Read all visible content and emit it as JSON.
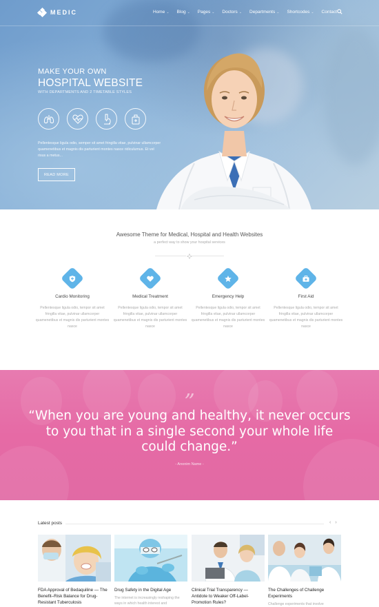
{
  "brand": {
    "name": "MEDIC"
  },
  "nav": {
    "items": [
      {
        "label": "Home",
        "dropdown": true
      },
      {
        "label": "Blog",
        "dropdown": true
      },
      {
        "label": "Pages",
        "dropdown": true
      },
      {
        "label": "Doctors",
        "dropdown": true
      },
      {
        "label": "Departments",
        "dropdown": true
      },
      {
        "label": "Shortcodes",
        "dropdown": true
      },
      {
        "label": "Contact",
        "dropdown": false
      }
    ]
  },
  "hero": {
    "line1": "MAKE YOUR OWN",
    "line2": "HOSPITAL WEBSITE",
    "line3": "WITH DEPARTMENTS AND 2 TIMETABLE STYLES",
    "icons": [
      "lungs-icon",
      "heart-pulse-icon",
      "microscope-icon",
      "medicine-bag-icon"
    ],
    "paragraph": "Pellentesque ligula odio, semper sit amet fringilla vitae, pulvinar ullamcorper quamenetibus et magnis dis parturient montes nasce ridiculumus. Et vel risus a metus...",
    "button": "READ MORE"
  },
  "services": {
    "title": "Awesome Theme for Medical, Hospital and Health Websites",
    "subtitle": "a perfect way to show your hospital services",
    "items": [
      {
        "title": "Cardio Monitoring",
        "icon": "shield-icon",
        "desc": "Pellentesque ligula odio, tempor sit amet fringilla vitae, pulvinar ullamcorper quamenetibus et magnis dis parturient montes nasce"
      },
      {
        "title": "Medical Treatment",
        "icon": "heart-icon",
        "desc": "Pellentesque ligula odio, tempor sit amet fringilla vitae, pulvinar ullamcorper quamenetibus et magnis dis parturient montes nasce"
      },
      {
        "title": "Emergency Help",
        "icon": "star-icon",
        "desc": "Pellentesque ligula odio, tempor sit amet fringilla vitae, pulvinar ullamcorper quamenetibus et magnis dis parturient montes nasce"
      },
      {
        "title": "First Aid",
        "icon": "first-aid-icon",
        "desc": "Pellentesque ligula odio, tempor sit amet fringilla vitae, pulvinar ullamcorper quamenetibus et magnis dis parturient montes nasce"
      }
    ]
  },
  "quote": {
    "mark": "”",
    "text": "“When you are young and healthy, it never occurs to you that in a single second your whole life could change.”",
    "author": "- Anonim Name -"
  },
  "posts": {
    "heading": "Latest posts",
    "prev": "‹",
    "next": "›",
    "items": [
      {
        "title": "FDA Approval of Bedaquiline — The Benefit–Risk Balance for Drug-Resistant Tuberculosis",
        "excerpt": ""
      },
      {
        "title": "Drug Safety in the Digital Age",
        "excerpt": "The internet is increasingly reshaping the ways in which health interest and"
      },
      {
        "title": "Clinical Trial Transparency — Antidote to Weaker Off-Label-Promotion Rules?",
        "excerpt": ""
      },
      {
        "title": "The Challenges of Challenge Experiments",
        "excerpt": "Challenge experiments that involve"
      }
    ]
  },
  "colors": {
    "accent": "#5fb4e8",
    "quote_bg": "#e66aa5"
  }
}
